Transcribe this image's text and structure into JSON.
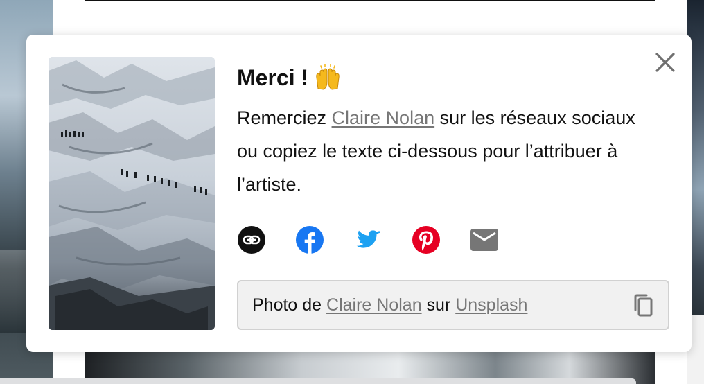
{
  "modal": {
    "title": "Merci !",
    "emoji": "raising-hands",
    "description": {
      "before": "Remerciez ",
      "author_link": "Claire Nolan",
      "after": " sur les réseaux sociaux ou copiez le texte ci-dessous pour l’attribuer à l’artiste."
    },
    "share": [
      {
        "name": "copy-link",
        "icon": "link-icon",
        "color": "#111111"
      },
      {
        "name": "facebook",
        "icon": "facebook-icon",
        "color": "#1877f2"
      },
      {
        "name": "twitter",
        "icon": "twitter-icon",
        "color": "#1da1f2"
      },
      {
        "name": "pinterest",
        "icon": "pinterest-icon",
        "color": "#e60023"
      },
      {
        "name": "email",
        "icon": "mail-icon",
        "color": "#767676"
      }
    ],
    "credit": {
      "prefix": "Photo de ",
      "author": "Claire Nolan",
      "middle": " sur ",
      "site": "Unsplash"
    }
  },
  "colors": {
    "link": "#767676",
    "credit_background": "#f1f1f1",
    "credit_border": "#d1d1d1"
  }
}
